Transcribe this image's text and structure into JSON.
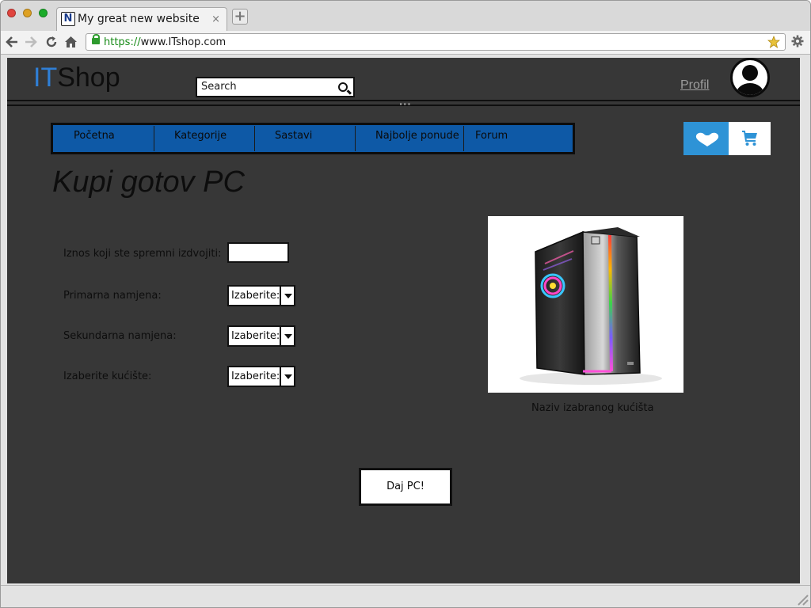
{
  "browser": {
    "tab_title": "My great new website",
    "tab_favicon": "N",
    "tab_close": "×",
    "new_tab": "+",
    "url_protocol": "https://",
    "url_host": "www.ITshop.com"
  },
  "header": {
    "logo_it": "IT",
    "logo_shop": "Shop",
    "search_text": "Search",
    "profil_link": "Profil",
    "grip": "···"
  },
  "nav": {
    "items": [
      {
        "label": "Početna"
      },
      {
        "label": "Kategorije"
      },
      {
        "label": "Sastavi"
      },
      {
        "label": "Najbolje ponude"
      },
      {
        "label": "Forum"
      }
    ]
  },
  "main": {
    "title": "Kupi gotov PC",
    "form": {
      "amount_label": "Iznos koji ste spremni izdvojiti:",
      "amount_value": "",
      "primary_label": "Primarna namjena:",
      "primary_value": "Izaberite:",
      "secondary_label": "Sekundarna namjena:",
      "secondary_value": "Izaberite:",
      "case_label": "Izaberite kućište:",
      "case_value": "Izaberite:"
    },
    "case_caption": "Naziv izabranog kućišta",
    "submit_label": "Daj PC!"
  },
  "colors": {
    "page_background": "#373737",
    "navbar": "#0e59a6",
    "accent": "#2e93d6",
    "logo_it": "#2f7fd6"
  },
  "icons": [
    "back-icon",
    "forward-icon",
    "reload-icon",
    "home-icon",
    "lock-icon",
    "bookmark-star-icon",
    "settings-gear-icon",
    "search-icon",
    "avatar-icon",
    "heart-icon",
    "cart-icon",
    "resize-grip-icon"
  ]
}
